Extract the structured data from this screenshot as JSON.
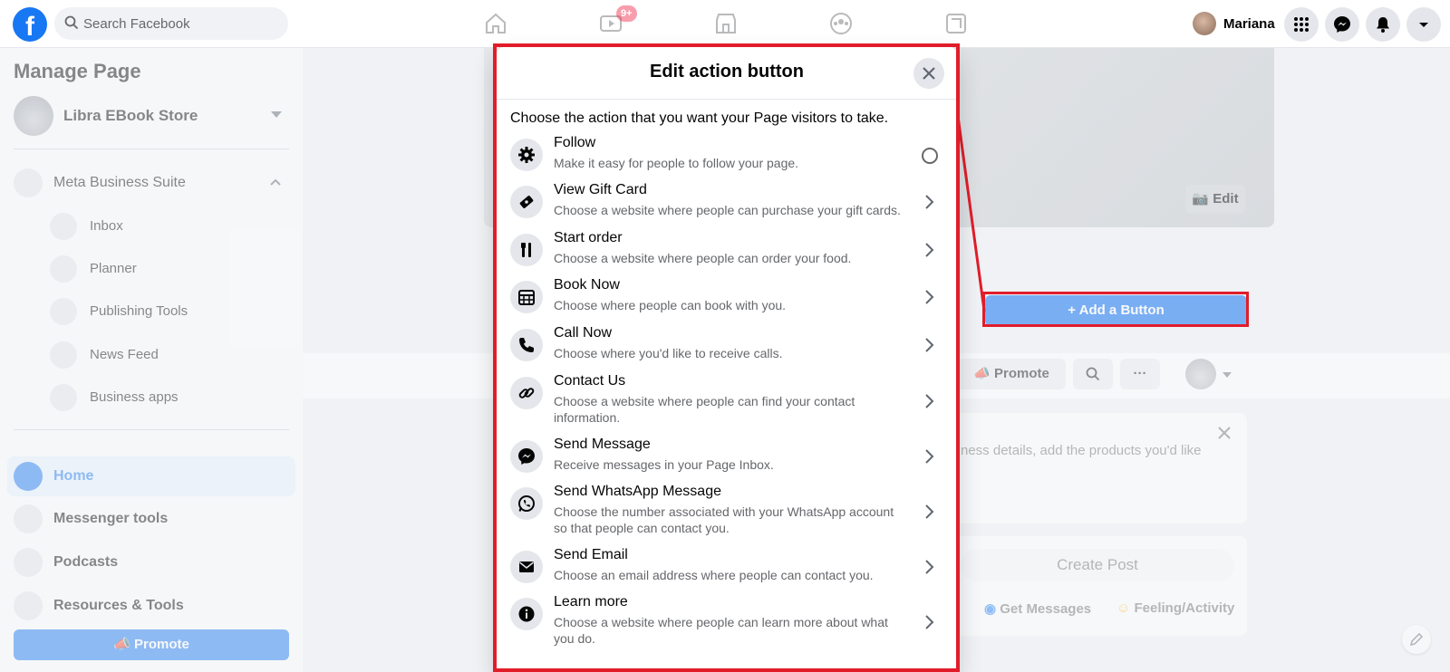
{
  "topbar": {
    "search_placeholder": "Search Facebook",
    "badge": "9+",
    "user_name": "Mariana"
  },
  "sidebar": {
    "title": "Manage Page",
    "page_name": "Libra EBook Store",
    "business_suite": "Meta Business Suite",
    "sub_items": [
      "Inbox",
      "Planner",
      "Publishing Tools",
      "News Feed",
      "Business apps"
    ],
    "items": [
      "Home",
      "Messenger tools",
      "Podcasts",
      "Resources & Tools"
    ],
    "promote": "Promote"
  },
  "main": {
    "cover_edit": "Edit",
    "add_button": "+ Add a Button",
    "promote": "Promote",
    "more": "···",
    "card_text": "ness details, add the products you'd like",
    "create_post": "Create Post",
    "get_messages": "Get Messages",
    "feeling": "Feeling/Activity"
  },
  "modal": {
    "title": "Edit action button",
    "intro": "Choose the action that you want your Page visitors to take.",
    "options": [
      {
        "title": "Follow",
        "desc": "Make it easy for people to follow your page.",
        "icon": "gear-icon"
      },
      {
        "title": "View Gift Card",
        "desc": "Choose a website where people can purchase your gift cards.",
        "icon": "ticket-icon"
      },
      {
        "title": "Start order",
        "desc": "Choose a website where people can order your food.",
        "icon": "utensils-icon"
      },
      {
        "title": "Book Now",
        "desc": "Choose where people can book with you.",
        "icon": "calendar-icon"
      },
      {
        "title": "Call Now",
        "desc": "Choose where you'd like to receive calls.",
        "icon": "phone-icon"
      },
      {
        "title": "Contact Us",
        "desc": "Choose a website where people can find your contact information.",
        "icon": "link-icon"
      },
      {
        "title": "Send Message",
        "desc": "Receive messages in your Page Inbox.",
        "icon": "messenger-icon"
      },
      {
        "title": "Send WhatsApp Message",
        "desc": "Choose the number associated with your WhatsApp account so that people can contact you.",
        "icon": "whatsapp-icon"
      },
      {
        "title": "Send Email",
        "desc": "Choose an email address where people can contact you.",
        "icon": "envelope-icon"
      },
      {
        "title": "Learn more",
        "desc": "Choose a website where people can learn more about what you do.",
        "icon": "info-icon"
      }
    ]
  },
  "colors": {
    "brand": "#1877f2",
    "highlight": "#e11d2a"
  }
}
